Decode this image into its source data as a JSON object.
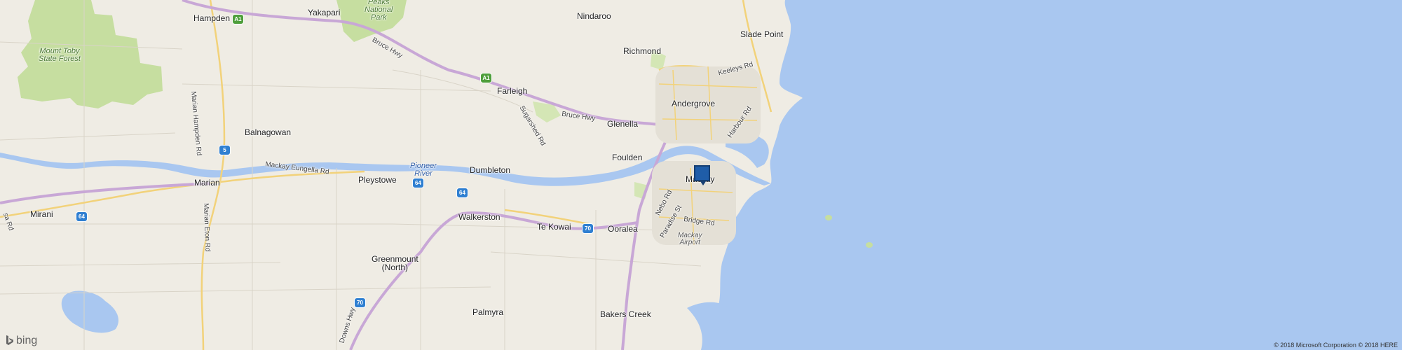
{
  "map": {
    "towns": [
      {
        "id": "hampden",
        "name": "Hampden"
      },
      {
        "id": "yakapari",
        "name": "Yakapari"
      },
      {
        "id": "nindaroo",
        "name": "Nindaroo"
      },
      {
        "id": "slade-point",
        "name": "Slade Point"
      },
      {
        "id": "richmond",
        "name": "Richmond"
      },
      {
        "id": "farleigh",
        "name": "Farleigh"
      },
      {
        "id": "andergrove",
        "name": "Andergrove"
      },
      {
        "id": "glenella",
        "name": "Glenella"
      },
      {
        "id": "balnagowan",
        "name": "Balnagowan"
      },
      {
        "id": "foulden",
        "name": "Foulden"
      },
      {
        "id": "dumbleton",
        "name": "Dumbleton"
      },
      {
        "id": "pleystowe",
        "name": "Pleystowe"
      },
      {
        "id": "marian",
        "name": "Marian"
      },
      {
        "id": "mackay",
        "name": "Mackay"
      },
      {
        "id": "mirani",
        "name": "Mirani"
      },
      {
        "id": "walkerston",
        "name": "Walkerston"
      },
      {
        "id": "te-kowai",
        "name": "Te Kowai"
      },
      {
        "id": "ooralea",
        "name": "Ooralea"
      },
      {
        "id": "greenmount",
        "name": "Greenmount\n(North)"
      },
      {
        "id": "palmyra",
        "name": "Palmyra"
      },
      {
        "id": "bakers-creek",
        "name": "Bakers Creek"
      }
    ],
    "roads": [
      {
        "id": "bruce-hwy-1",
        "name": "Bruce Hwy"
      },
      {
        "id": "bruce-hwy-2",
        "name": "Bruce Hwy"
      },
      {
        "id": "marian-hampden-rd",
        "name": "Marian Hampden Rd"
      },
      {
        "id": "mackay-eungella-rd",
        "name": "Mackay Eungella Rd"
      },
      {
        "id": "marian-eton-rd",
        "name": "Marian Eton Rd"
      },
      {
        "id": "nebo-rd",
        "name": "Nebo Rd"
      },
      {
        "id": "keeleys-rd",
        "name": "Keeleys Rd"
      },
      {
        "id": "harbour-rd",
        "name": "Harbour Rd"
      },
      {
        "id": "sugarshed-rd",
        "name": "Sugarshed Rd"
      },
      {
        "id": "bridge-rd",
        "name": "Bridge Rd"
      },
      {
        "id": "paradise-st",
        "name": "Paradise St"
      },
      {
        "id": "downs-hwy",
        "name": "Downs Hwy"
      },
      {
        "id": "misc-rd",
        "name": "sa Rd"
      }
    ],
    "parks": [
      {
        "id": "mount-toby",
        "name": "Mount Toby\nState Forest"
      },
      {
        "id": "peaks-np",
        "name": "Peaks\nNational\nPark"
      }
    ],
    "water": [
      {
        "id": "pioneer-river",
        "name": "Pioneer\nRiver"
      }
    ],
    "airport": {
      "name": "Mackay\nAirport"
    },
    "shields": [
      {
        "id": "a1-north",
        "label": "A1",
        "color": "green"
      },
      {
        "id": "a1-farleigh",
        "label": "A1",
        "color": "green"
      },
      {
        "id": "r5",
        "label": "5",
        "color": "blue"
      },
      {
        "id": "r64-a",
        "label": "64",
        "color": "blue"
      },
      {
        "id": "r64-b",
        "label": "64",
        "color": "blue"
      },
      {
        "id": "r64-c",
        "label": "64",
        "color": "blue"
      },
      {
        "id": "r70-a",
        "label": "70",
        "color": "blue"
      },
      {
        "id": "r70-b",
        "label": "70",
        "color": "blue"
      }
    ],
    "pin": {
      "label": "location-pin"
    },
    "logo": {
      "text": "bing"
    },
    "copyright": "© 2018 Microsoft Corporation © 2018 HERE"
  },
  "colors": {
    "sea": "#a9c7f0",
    "land": "#efece4",
    "park": "#c6dea0",
    "highway": "#c8a7d6",
    "major_road": "#f2d27a",
    "pin": "#1f5da8"
  }
}
